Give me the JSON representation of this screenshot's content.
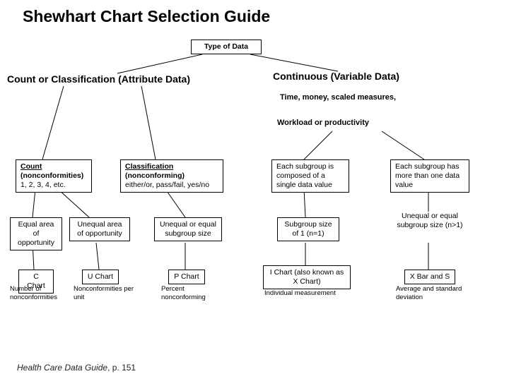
{
  "title": "Shewhart Chart Selection Guide",
  "root": {
    "label": "Type of Data"
  },
  "attribute": {
    "label": "Count or Classification (Attribute Data)",
    "count": {
      "label": "Count (nonconformities) 1, 2, 3, 4, etc.",
      "title": "Count",
      "sub1": "(nonconformities)",
      "sub2": "1, 2, 3, 4, etc.",
      "equal": {
        "label": "Equal area of opportunity",
        "chart": {
          "name": "C Chart",
          "desc": "Number of nonconformities"
        }
      },
      "unequal": {
        "label": "Unequal area of opportunity",
        "chart": {
          "name": "U Chart",
          "desc": "Nonconformities per unit"
        }
      }
    },
    "classification": {
      "title": "Classification",
      "sub1": "(nonconforming)",
      "sub2": "either/or, pass/fail, yes/no",
      "subgroup": {
        "label": "Unequal or equal subgroup size",
        "chart": {
          "name": "P Chart",
          "desc": "Percent nonconforming"
        }
      }
    }
  },
  "variable": {
    "label": "Continuous (Variable Data)",
    "ex1": "Time, money, scaled measures,",
    "ex2": "Workload or productivity",
    "single": {
      "label": "Each subgroup is composed of a single data value",
      "size": {
        "label": "Subgroup size of 1 (n=1)",
        "chart": {
          "name": "I Chart (also known as X Chart)",
          "desc": "Individual measurement"
        }
      }
    },
    "multi": {
      "label": "Each subgroup has more than one data value",
      "size": {
        "label": "Unequal or equal subgroup size (n>1)",
        "chart": {
          "name": "X Bar and S",
          "desc": "Average and standard deviation"
        }
      }
    }
  },
  "footer": {
    "book": "Health Care Data Guide",
    "page": ", p. 151"
  }
}
